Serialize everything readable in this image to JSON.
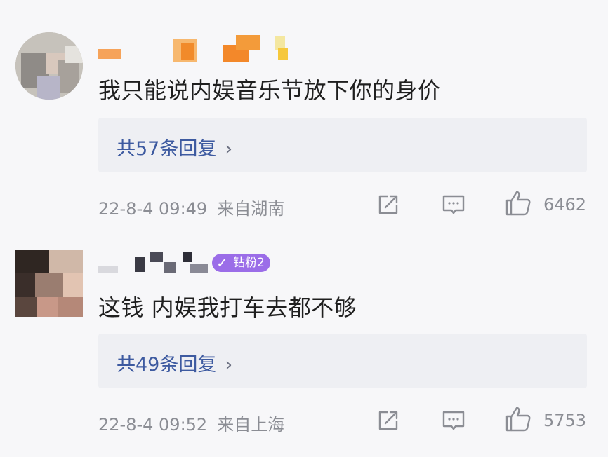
{
  "comments": [
    {
      "text": "我只能说内娱音乐节放下你的身价",
      "reply_link": "共57条回复",
      "timestamp": "22-8-4 09:49",
      "location": "来自湖南",
      "likes": "6462"
    },
    {
      "text": "这钱 内娱我打车去都不够",
      "reply_link": "共49条回复",
      "timestamp": "22-8-4 09:52",
      "location": "来自上海",
      "likes": "5753",
      "badge": "钻粉2"
    }
  ],
  "icons": {
    "chevron": "chevron-right-icon",
    "share": "share-icon",
    "comment": "comment-icon",
    "like": "thumbs-up-icon"
  },
  "colors": {
    "reply_link": "#3d5aa0",
    "meta_text": "#8b8d94",
    "reply_bg": "#eeeff3",
    "badge": "#9b6de8"
  }
}
